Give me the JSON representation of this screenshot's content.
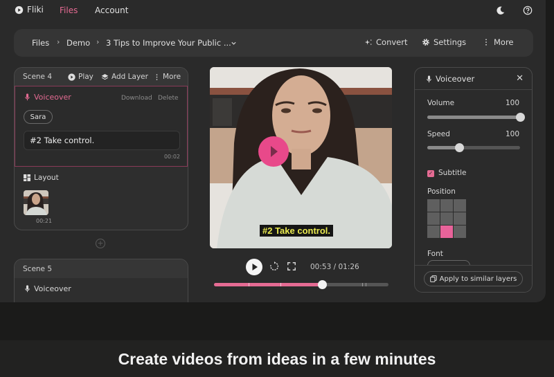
{
  "topnav": {
    "brand": "Fliki",
    "links": [
      {
        "label": "Files",
        "active": true
      },
      {
        "label": "Account",
        "active": false
      }
    ],
    "icons": [
      "moon-icon",
      "help-icon"
    ]
  },
  "toolbar": {
    "breadcrumb": [
      "Files",
      "Demo",
      "3 Tips to Improve Your Public ..."
    ],
    "actions": [
      {
        "label": "Convert",
        "icon": "sparkle-icon"
      },
      {
        "label": "Settings",
        "icon": "gear-icon"
      },
      {
        "label": "More",
        "icon": "kebab-icon"
      }
    ]
  },
  "scene4": {
    "title": "Scene 4",
    "actions": [
      "Play",
      "Add Layer",
      "More"
    ],
    "voiceover": {
      "title": "Voiceover",
      "download": "Download",
      "delete": "Delete",
      "voice": "Sara",
      "text": "#2 Take control.",
      "duration": "00:02"
    },
    "layout": {
      "title": "Layout",
      "thumb_duration": "00:21"
    }
  },
  "scene5": {
    "title": "Scene 5",
    "voiceover_title": "Voiceover"
  },
  "video": {
    "subtitle": "#2 Take control.",
    "accent": "#e8498a"
  },
  "player": {
    "current": "00:53",
    "total": "01:26",
    "time_text": "00:53 / 01:26",
    "progress": 0.62,
    "markers": [
      0.2,
      0.38,
      0.85,
      0.87
    ]
  },
  "panel": {
    "title": "Voiceover",
    "volume_label": "Volume",
    "volume_value": "100",
    "volume_fraction": 1.0,
    "speed_label": "Speed",
    "speed_value": "100",
    "speed_fraction": 0.34,
    "subtitle_label": "Subtitle",
    "subtitle_checked": true,
    "position_label": "Position",
    "position_selected": 7,
    "font_label": "Font",
    "apply_label": "Apply to similar layers"
  },
  "caption": "Create videos from ideas in a few minutes",
  "colors": {
    "accent": "#e56b93",
    "background": "#2a2a2a",
    "subtitle_text": "#eaea50"
  }
}
